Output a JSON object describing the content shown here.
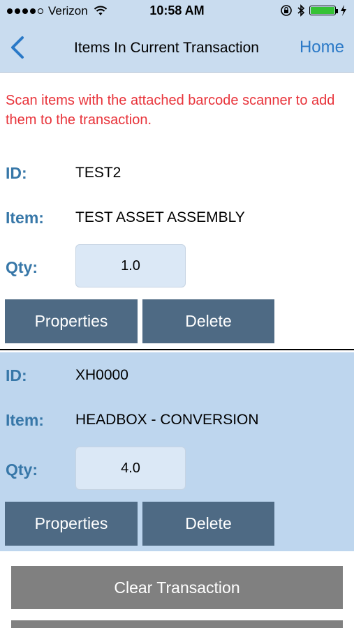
{
  "status_bar": {
    "carrier": "Verizon",
    "time": "10:58 AM",
    "battery_color": "#35c235"
  },
  "nav": {
    "back_icon": "chevron-left-icon",
    "title": "Items In Current Transaction",
    "home_label": "Home"
  },
  "instruction": "Scan items with the attached barcode scanner to add them to the transaction.",
  "items": [
    {
      "id_label": "ID:",
      "id_value": "TEST2",
      "item_label": "Item:",
      "item_value": "TEST ASSET ASSEMBLY",
      "qty_label": "Qty:",
      "qty_value": "1.0",
      "properties_label": "Properties",
      "delete_label": "Delete"
    },
    {
      "id_label": "ID:",
      "id_value": "XH0000",
      "item_label": "Item:",
      "item_value": "HEADBOX - CONVERSION",
      "qty_label": "Qty:",
      "qty_value": "4.0",
      "properties_label": "Properties",
      "delete_label": "Delete"
    }
  ],
  "footer": {
    "clear_label": "Clear Transaction"
  },
  "colors": {
    "accent": "#2a79c7",
    "label_blue": "#3777a8",
    "warning_red": "#e8333a",
    "button_slate": "#4e6a84",
    "nav_bg": "#c9dcef",
    "alt_row_bg": "#bed6ee"
  }
}
